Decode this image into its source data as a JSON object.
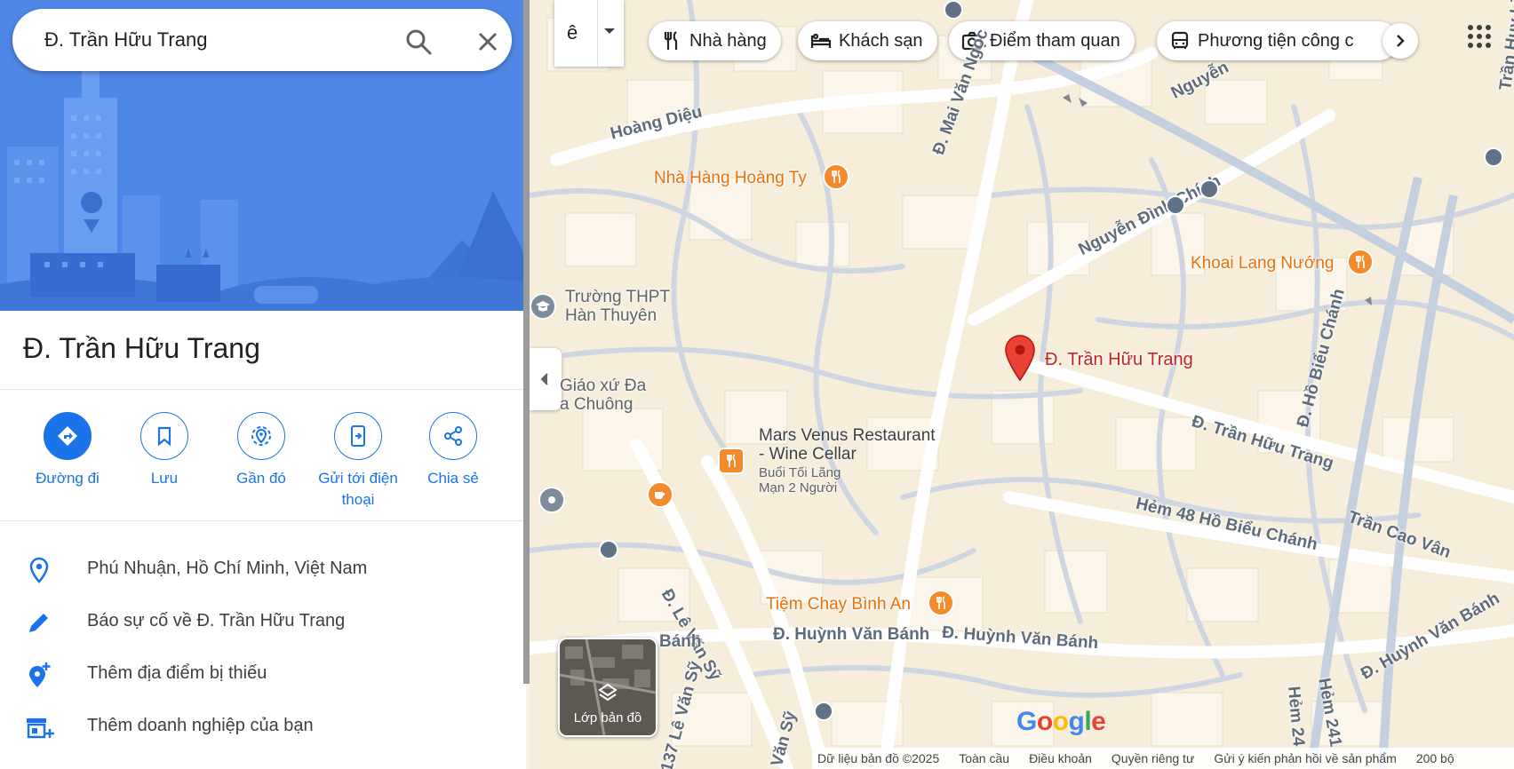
{
  "search": {
    "value": "Đ. Trần Hữu Trang"
  },
  "place": {
    "title": "Đ. Trần Hữu Trang"
  },
  "actions": [
    {
      "label": "Đường đi"
    },
    {
      "label": "Lưu"
    },
    {
      "label": "Gần đó"
    },
    {
      "label": "Gửi tới điện\nthoại"
    },
    {
      "label": "Chia sẻ"
    }
  ],
  "info": {
    "address": "Phú Nhuận, Hồ Chí Minh, Việt Nam",
    "report": "Báo sự cố về Đ. Trần Hữu Trang",
    "add_place": "Thêm địa điểm bị thiếu",
    "add_business": "Thêm doanh nghiệp của bạn"
  },
  "map": {
    "lang_toggle": "ê",
    "chips": [
      "Nhà hàng",
      "Khách sạn",
      "Điểm tham quan",
      "Phương tiện công c"
    ],
    "pin_label": "Đ. Trần Hữu Trang",
    "streets": {
      "hoang_dieu": "Hoàng Diệu",
      "mai_van_ngoc": "Đ. Mai Văn Ngọc",
      "nguyen_dinh_chinh": "Nguyễn Đình Chính",
      "nguyen": "Nguyễn",
      "ho_bieu_chanh": "Đ. Hồ Biểu Chánh",
      "tran_huu_trang": "Đ. Trần Hữu Trang",
      "hem48": "Hẻm 48 Hồ Biểu Chánh",
      "tran_cao_van": "Trần Cao Vân",
      "huynh_van_banh_1": "Đ. Huỳnh Văn Bánh",
      "huynh_van_banh_2": "Đ. Huỳnh Văn Bánh",
      "huynh_van_banh_3": "Đ. Huỳnh Văn Bánh",
      "le_van_sy": "Đ. Lê Văn Sỹ",
      "le_van_sy_137": "137 Lê Văn Sỹ",
      "van_sy": "Văn Sỹ",
      "banh": "Bánh",
      "hem241": "Hẻm 241",
      "hem24": "Hẻm 24",
      "huy_lieu": "Trần Huy Liệu"
    },
    "pois": {
      "hoang_ty": "Nhà Hàng Hoàng Ty",
      "khoai_lang": "Khoai Lang Nướng",
      "thpt": "Trường THPT\nHàn Thuyên",
      "giao_xu": "Giáo xứ Đa\na Chuông",
      "mars_venus": "Mars Venus Restaurant\n- Wine Cellar",
      "buoi_toi": "Buổi Tối Lãng\nMạn 2 Người",
      "tiem_chay": "Tiệm Chay Bình An"
    },
    "layers_label": "Lớp bản đồ",
    "google_logo": "Google",
    "footer": {
      "data": "Dữ liệu bản đồ ©2025",
      "global": "Toàn cầu",
      "terms": "Điều khoản",
      "privacy": "Quyền riêng tư",
      "feedback": "Gửi ý kiến phản hồi về sản phẩm",
      "scale": "200 bộ"
    }
  },
  "colors": {
    "accent": "#1a73e8",
    "poi_orange": "#e8710a",
    "pin_red": "#ea4335",
    "hero_blue": "#4e86e4"
  }
}
